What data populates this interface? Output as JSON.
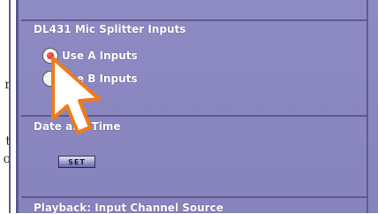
{
  "page_fragments": [
    "r",
    "t",
    "o"
  ],
  "mic_splitter": {
    "title": "DL431 Mic Splitter Inputs",
    "options": [
      {
        "label": "Use A Inputs",
        "selected": true
      },
      {
        "label": "Use B Inputs",
        "selected": false
      }
    ]
  },
  "date_time": {
    "title": "Date and Time",
    "set_button": "SET"
  },
  "playback": {
    "title": "Playback: Input Channel Source"
  },
  "cursor_icon": "arrow-cursor-icon",
  "colors": {
    "panel_bg": "#8b87c1",
    "divider": "#5d5a8e",
    "text": "#ffffff",
    "cursor_outline": "#f07a1a",
    "radio_dot": "#dd2a1e"
  }
}
